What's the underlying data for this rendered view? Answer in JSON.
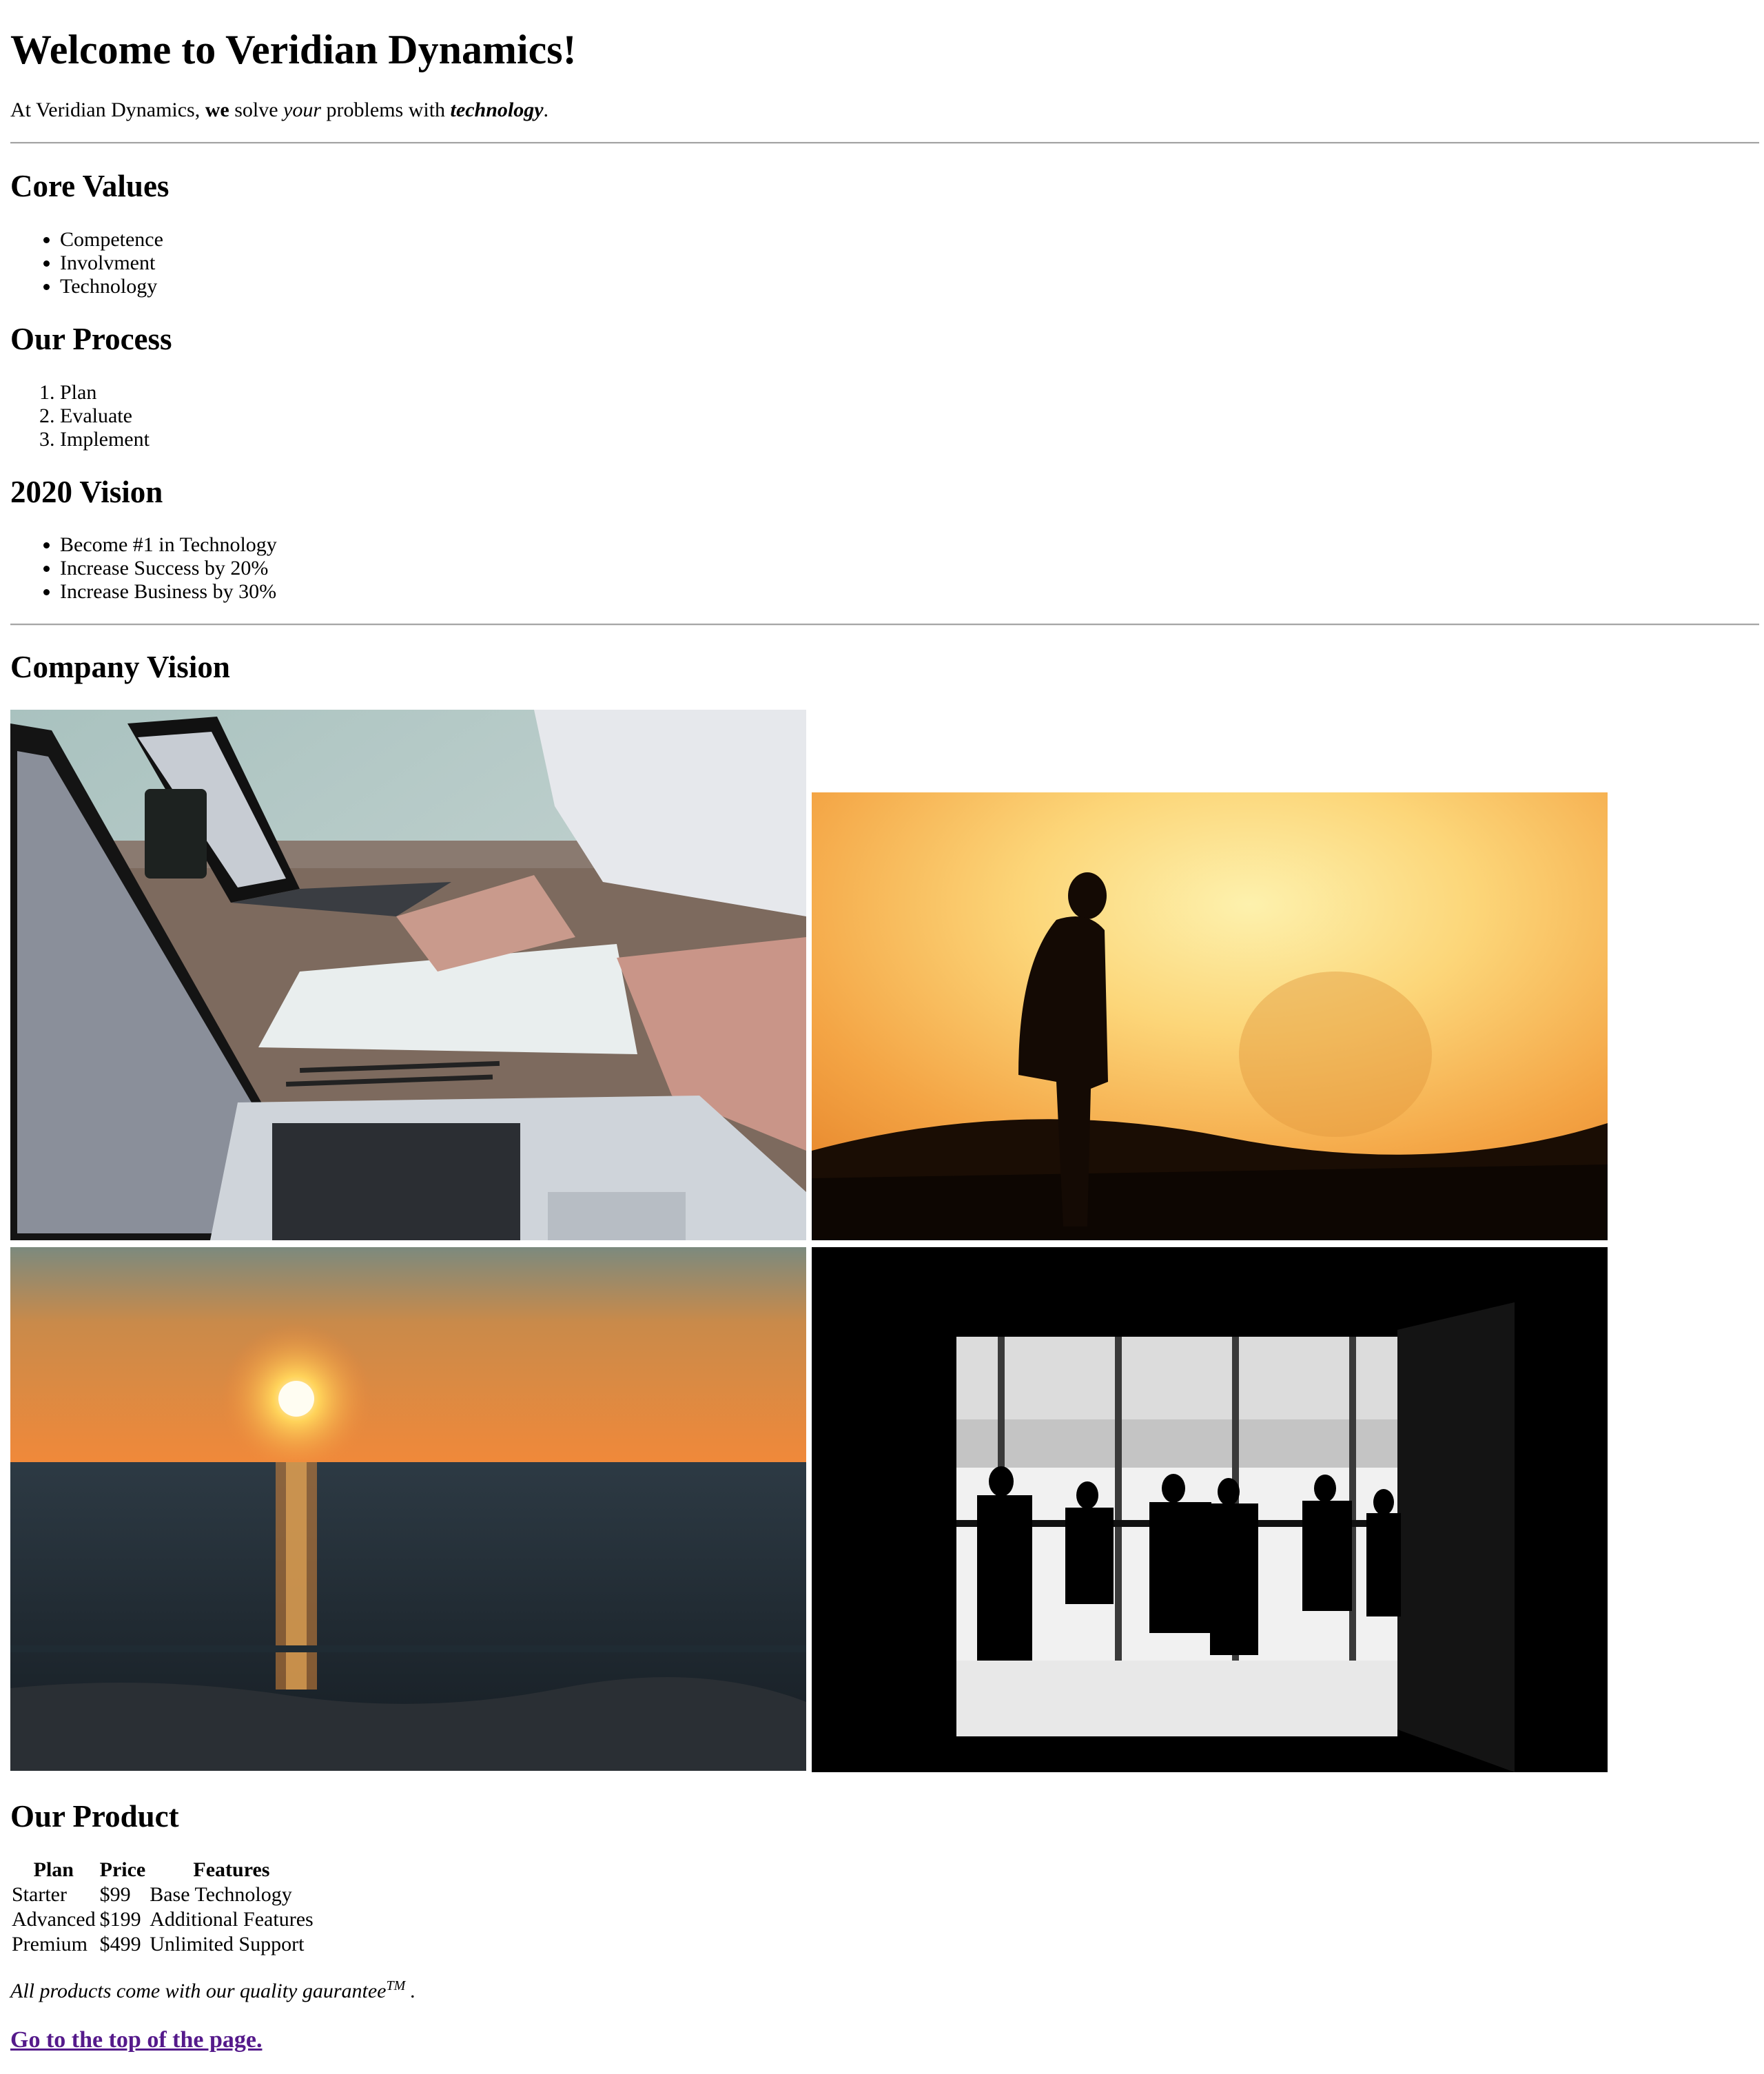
{
  "header": {
    "title": "Welcome to Veridian Dynamics!",
    "intro": {
      "part1": "At Veridian Dynamics, ",
      "we": "we",
      "part2": " solve ",
      "your": "your",
      "part3": " problems with ",
      "technology": "technology",
      "end": "."
    }
  },
  "core_values": {
    "heading": "Core Values",
    "items": [
      "Competence",
      "Involvment",
      "Technology"
    ]
  },
  "process": {
    "heading": "Our Process",
    "items": [
      "Plan",
      "Evaluate",
      "Implement"
    ]
  },
  "vision2020": {
    "heading": "2020 Vision",
    "items": [
      "Become #1 in Technology",
      "Increase Success by 20%",
      "Increase Business by 30%"
    ]
  },
  "company_vision": {
    "heading": "Company Vision"
  },
  "product": {
    "heading": "Our Product",
    "columns": [
      "Plan",
      "Price",
      "Features"
    ],
    "rows": [
      [
        "Starter",
        "$99",
        "Base Technology"
      ],
      [
        "Advanced",
        "$199",
        "Additional Features"
      ],
      [
        "Premium",
        "$499",
        "Unlimited Support"
      ]
    ],
    "guarantee_text": "All products come with our quality gaurantee",
    "guarantee_mark": "TM",
    "guarantee_end": " .",
    "top_link": "Go to the top of the page."
  },
  "colors": {
    "link_visited": "#551a8b",
    "hr": "#a5a5a5"
  }
}
